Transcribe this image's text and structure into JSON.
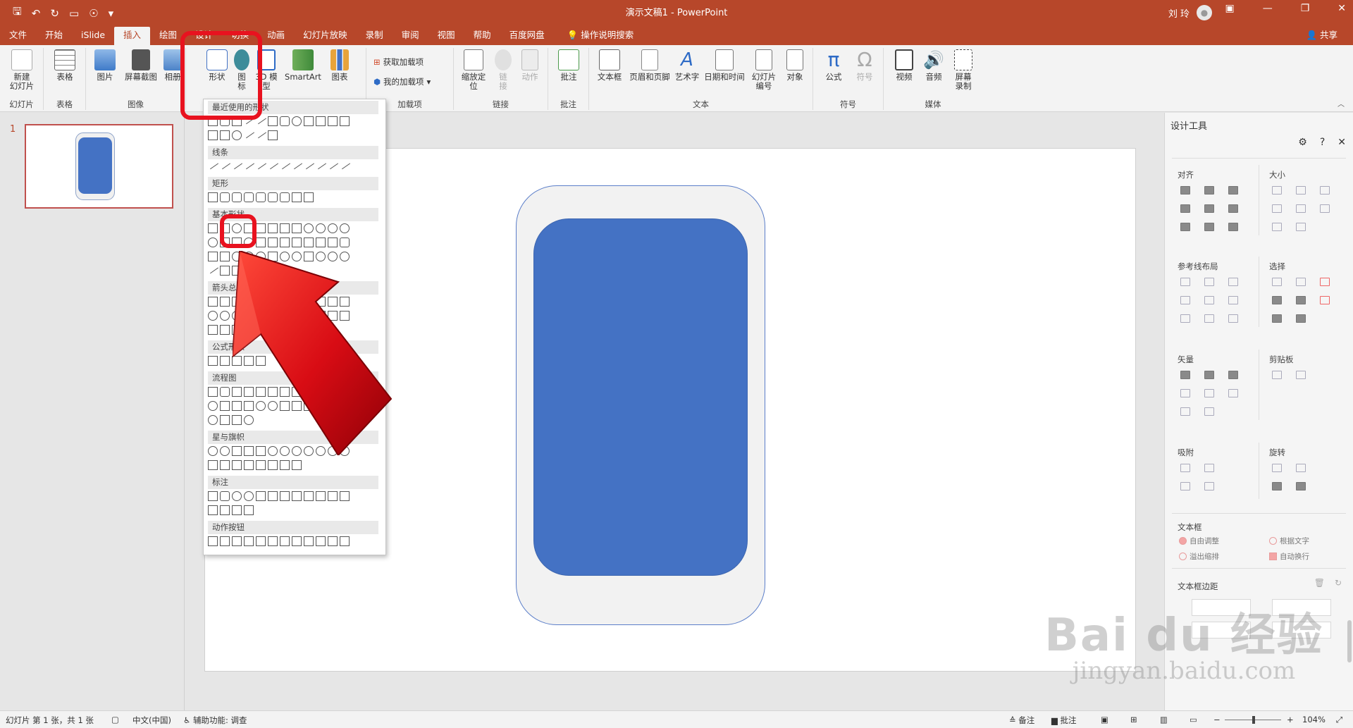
{
  "window": {
    "title": "演示文稿1  -  PowerPoint",
    "user": "刘 玲"
  },
  "tabs": [
    "文件",
    "开始",
    "iSlide",
    "插入",
    "绘图",
    "设计",
    "切换",
    "动画",
    "幻灯片放映",
    "录制",
    "审阅",
    "视图",
    "帮助",
    "百度网盘",
    "操作说明搜索"
  ],
  "share": "共享",
  "ribbon": {
    "new_slide": "新建\n幻灯片",
    "slide_group": "幻灯片",
    "table": "表格",
    "table_group": "表格",
    "picture": "图片",
    "screenshot": "屏幕截图",
    "album": "相册",
    "image_group": "图像",
    "shapes": "形状",
    "icons": "图\n标",
    "model3d": "3D 模\n型",
    "smartart": "SmartArt",
    "chart": "图表",
    "get_addins": "获取加载项",
    "my_addins": "我的加载项",
    "addins_group": "加载项",
    "zoom": "缩放定\n位",
    "link": "链\n接",
    "action": "动作",
    "links_group": "链接",
    "comment": "批注",
    "comment_group": "批注",
    "textbox": "文本框",
    "header_footer": "页眉和页脚",
    "wordart": "艺术字",
    "datetime": "日期和时间",
    "slide_number": "幻灯片\n编号",
    "object": "对象",
    "text_group": "文本",
    "equation": "公式",
    "symbol": "符号",
    "symbols_group": "符号",
    "video": "视频",
    "audio": "音频",
    "screen_record": "屏幕\n录制",
    "media_group": "媒体"
  },
  "thumbnails": {
    "number": "1"
  },
  "shapes_menu": {
    "recent": "最近使用的形状",
    "lines": "线条",
    "rectangles": "矩形",
    "basic": "基本形状",
    "arrows": "箭头总汇",
    "equation": "公式形状",
    "flowchart": "流程图",
    "stars": "星与旗帜",
    "callouts": "标注",
    "action_buttons": "动作按钮"
  },
  "design_pane": {
    "title": "设计工具",
    "align": "对齐",
    "size": "大小",
    "guides": "参考线布局",
    "select": "选择",
    "vector": "矢量",
    "clipboard": "剪贴板",
    "snap": "吸附",
    "rotate": "旋转",
    "textbox": "文本框",
    "auto_fit": "自由调整",
    "fit_text": "根据文字",
    "overflow": "溢出缩排",
    "wrap": "自动换行",
    "margins": "文本框边距"
  },
  "status": {
    "slide_info": "幻灯片 第 1 张，共 1 张",
    "language": "中文(中国)",
    "accessibility": "辅助功能: 调查",
    "notes": "备注",
    "comments": "批注",
    "zoom": "104%"
  },
  "watermark": {
    "line1": "Bai du 经验",
    "line2": "jingyan.baidu.com"
  },
  "colors": {
    "accent": "#b7472a",
    "shape_fill": "#4472c4",
    "highlight": "#e8121f"
  }
}
